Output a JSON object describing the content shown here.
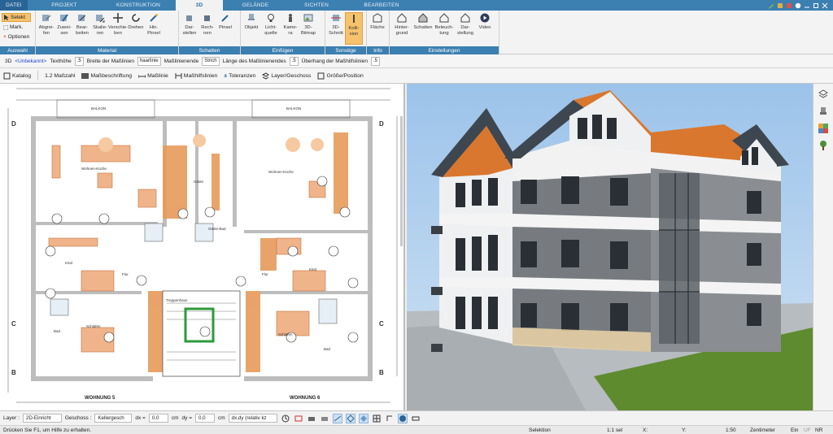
{
  "tabs": [
    {
      "label": "DATEI"
    },
    {
      "label": "PROJEKT"
    },
    {
      "label": "KONSTRUKTION"
    },
    {
      "label": "3D"
    },
    {
      "label": "GELÄNDE"
    },
    {
      "label": "SICHTEN"
    },
    {
      "label": "BEARBEITEN"
    }
  ],
  "ribbon": {
    "selection": {
      "items": [
        "Selekt",
        "Mark.",
        "Optionen"
      ],
      "label": "Auswahl"
    },
    "material": {
      "buttons": [
        "Abgrei-\nfen",
        "Zuwei-\nsen",
        "Bear-\nbeiten",
        "Skalie-\nren",
        "Verschie-\nben",
        "Drehen",
        "Hin.\nPinsel"
      ],
      "label": "Material"
    },
    "schatten": {
      "buttons": [
        "Dar-\nstellen",
        "Rech-\nnen",
        "Pinsel"
      ],
      "label": "Schatten"
    },
    "einfuegen": {
      "buttons": [
        "Objekt",
        "Licht-\nquelle",
        "Kame-\nra",
        "3D-\nBitmap"
      ],
      "label": "Einfügen"
    },
    "sonstige": {
      "buttons": [
        "3D-\nSchnitt",
        "Kolli-\nsion"
      ],
      "label": "Sonstige"
    },
    "info": {
      "buttons": [
        "Fläche"
      ],
      "label": "Info"
    },
    "einstellungen": {
      "buttons": [
        "Hinter-\ngrund",
        "Schatten",
        "Beleuch-\ntung",
        "Dar-\nstellung",
        "Video"
      ],
      "label": "Einstellungen"
    }
  },
  "propbar": {
    "mode": "3D",
    "layer_value": "<Unbekannt>",
    "text_height_label": "Texthöhe",
    "text_height_value": ".5",
    "line_width_label": "Breite der Maßlinien",
    "line_width_value": "haarlinie",
    "line_end_label": "Maßlinienende",
    "line_end_value": "Strich",
    "line_end_length_label": "Länge des Maßlinienendes",
    "line_end_length_value": ".5",
    "overhang_label": "Überhang der Maßhilfslinien",
    "overhang_value": ".5"
  },
  "toolbar2": {
    "items": [
      "Katalog",
      "1.2 Maßzahl",
      "Maßbeschriftung",
      "Maßlinie",
      "Maßhilfslinien",
      "Toleranzen",
      "Layer/Geschoss",
      "Größe/Position"
    ]
  },
  "plan": {
    "labels": {
      "wohnung5": "WOHNUNG 5",
      "wohnung6": "WOHNUNG 6",
      "balkon": "BALKON",
      "wohnen_kueche": "Wohnen-Küche",
      "gaeste": "Gäste",
      "kind": "Kind",
      "flur": "Flur",
      "bad": "Bad",
      "schlafen": "Schlafen",
      "gaeste_bad": "Gäste-Bad",
      "treppenhaus": "Treppenhaus"
    },
    "axis_letters": {
      "top": "D",
      "middle": "C",
      "bottom": "B"
    }
  },
  "editbar": {
    "layer_label": "Layer :",
    "layer_value": "2D-Einricht",
    "floor_label": "Geschoss :",
    "floor_value": "Kellergesch",
    "dx_label": "dx =",
    "dx_value": "0,0",
    "dx_unit": "cm",
    "dy_label": "dy =",
    "dy_value": "0,0",
    "dy_unit": "cm",
    "mode_value": "dx,dy (relativ kz"
  },
  "status": {
    "help": "Drücken Sie F1, um Hilfe zu erhalten.",
    "mode": "Selektion",
    "scale": "1:1 sel",
    "x": "X:",
    "y": "Y:",
    "ratio": "1:50",
    "unit": "Zentimeter",
    "on": "Ein",
    "uf": "UF",
    "nr": "NR"
  },
  "colors": {
    "accent": "#3c7fb1",
    "wall": "#e79a5a",
    "roof": "#d9772e",
    "sky": "#a6c9ec",
    "grass": "#5f8b2f"
  }
}
